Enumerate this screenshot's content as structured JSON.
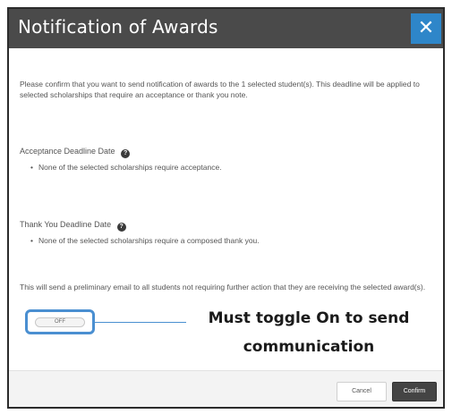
{
  "modal": {
    "title": "Notification of Awards",
    "close_glyph": "✕",
    "intro": "Please confirm that you want to send notification of awards to the 1 selected student(s). This deadline will be applied to selected scholarships that require an acceptance or thank you note.",
    "acceptance": {
      "label": "Acceptance Deadline Date",
      "help_glyph": "?",
      "note": "None of the selected scholarships require acceptance."
    },
    "thank_you": {
      "label": "Thank You Deadline Date",
      "help_glyph": "?",
      "note": "None of the selected scholarships require a composed thank you."
    },
    "preliminary": "This will send a preliminary email to all students not requiring further action that they are receiving the selected award(s).",
    "toggle_label": "OFF",
    "callout": "Must toggle On to send communication",
    "cancel_label": "Cancel",
    "confirm_label": "Confirm"
  },
  "colors": {
    "header_bg": "#4a4a4a",
    "close_bg": "#2e86c9",
    "highlight": "#4a8fd1",
    "confirm_bg": "#444444"
  },
  "icons": {
    "close": "close-icon",
    "help": "question-circle-icon"
  }
}
